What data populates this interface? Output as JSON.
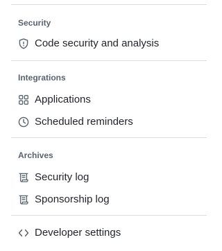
{
  "sections": [
    {
      "heading": "Security",
      "items": [
        {
          "label": "Code security and analysis",
          "icon": "shield-icon"
        }
      ]
    },
    {
      "heading": "Integrations",
      "items": [
        {
          "label": "Applications",
          "icon": "apps-grid-icon"
        },
        {
          "label": "Scheduled reminders",
          "icon": "clock-icon"
        }
      ]
    },
    {
      "heading": "Archives",
      "items": [
        {
          "label": "Security log",
          "icon": "log-icon"
        },
        {
          "label": "Sponsorship log",
          "icon": "log-icon"
        }
      ]
    }
  ],
  "footer": {
    "developer_settings": {
      "label": "Developer settings",
      "icon": "code-icon"
    }
  },
  "colors": {
    "heading": "#59636e",
    "text": "#1f2328",
    "divider": "#d8dee4",
    "icon": "#59636e"
  }
}
